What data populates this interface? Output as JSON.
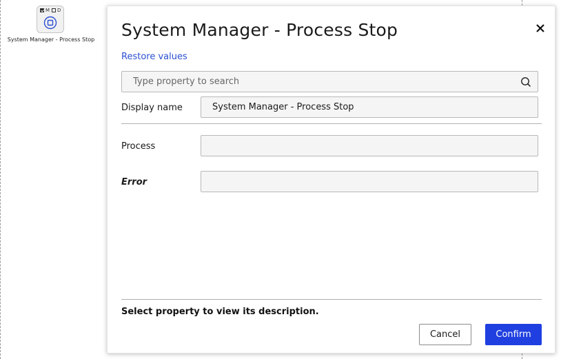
{
  "canvas": {
    "node": {
      "flags": [
        "M",
        "D"
      ],
      "flag_checked": [
        true,
        false
      ],
      "icon": "stop-circle-icon",
      "label": "System Manager - Process Stop"
    }
  },
  "dialog": {
    "title": "System Manager - Process Stop",
    "close_icon": "close-icon",
    "restore_label": "Restore values",
    "search": {
      "placeholder": "Type property to search",
      "value": "",
      "icon": "search-icon"
    },
    "properties": [
      {
        "label": "Display name",
        "value": "System Manager - Process Stop"
      },
      {
        "label": "Process",
        "value": ""
      },
      {
        "label": "Error",
        "value": ""
      }
    ],
    "description": "Select property to view its description.",
    "cancel_label": "Cancel",
    "confirm_label": "Confirm"
  },
  "colors": {
    "accent": "#1f3fe0",
    "link": "#2b4fd1",
    "node_icon": "#2b4fd1"
  }
}
